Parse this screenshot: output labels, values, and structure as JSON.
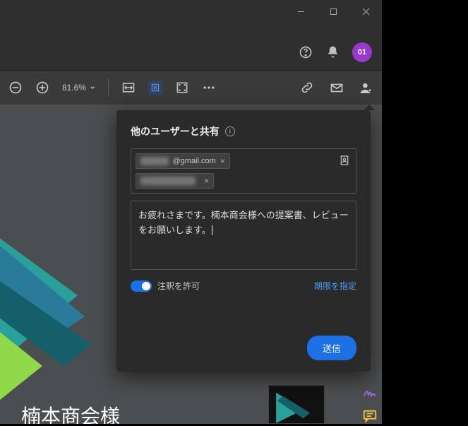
{
  "window": {
    "zoom": "81.6%"
  },
  "header": {
    "avatar_initials": "01"
  },
  "share": {
    "title": "他のユーザーと共有",
    "recipients": [
      {
        "visible": "@gmail.com"
      },
      {
        "visible": ""
      }
    ],
    "message": "お疲れさまです。楠本商会様への提案書、レビューをお願いします。",
    "allow_comments_label": "注釈を許可",
    "deadline_label": "期限を指定",
    "send_label": "送信"
  },
  "document": {
    "heading": "楠本商会様"
  }
}
